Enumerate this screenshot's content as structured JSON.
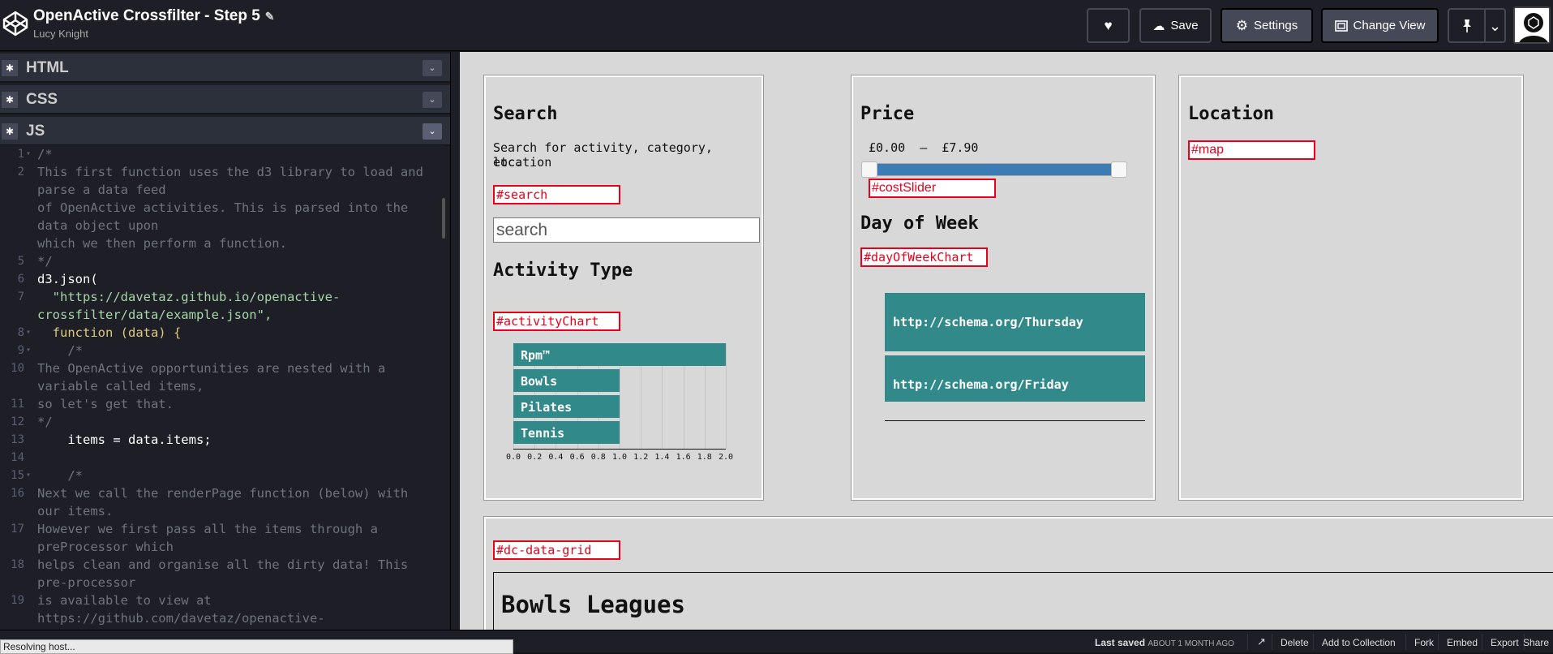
{
  "header": {
    "title": "OpenActive Crossfilter - Step 5",
    "edit_glyph": "✎",
    "author": "Lucy Knight",
    "save_label": "Save",
    "settings_label": "Settings",
    "change_view_label": "Change View",
    "heart_icon": "♥",
    "cloud_icon": "☁",
    "gear_icon": "⚙",
    "pin_icon": "📌",
    "chevron": "⌄"
  },
  "panes": {
    "html": "HTML",
    "css": "CSS",
    "js": "JS",
    "gear": "✱",
    "toggle": "⌄"
  },
  "code": [
    {
      "n": "1",
      "fold": "▾",
      "t": "/*",
      "c": "comment"
    },
    {
      "n": "2",
      "fold": "",
      "t": "This first function uses the d3 library to load and",
      "c": "comment"
    },
    {
      "n": "",
      "fold": "",
      "t": "parse a data feed",
      "c": "comment"
    },
    {
      "n": "",
      "fold": "",
      "t": "of OpenActive activities. This is parsed into the",
      "c": "comment"
    },
    {
      "n": "",
      "fold": "",
      "t": "data object upon",
      "c": "comment"
    },
    {
      "n": "",
      "fold": "",
      "t": "which we then perform a function.",
      "c": "comment"
    },
    {
      "n": "5",
      "fold": "",
      "t": "*/",
      "c": "comment"
    },
    {
      "n": "6",
      "fold": "",
      "t": "d3.json(",
      "c": "plain"
    },
    {
      "n": "7",
      "fold": "",
      "t": "  \"https://davetaz.github.io/openactive-",
      "c": "str"
    },
    {
      "n": "",
      "fold": "",
      "t": "crossfilter/data/example.json\",",
      "c": "str"
    },
    {
      "n": "8",
      "fold": "▾",
      "t": "  function (data) {",
      "c": "kw"
    },
    {
      "n": "9",
      "fold": "▾",
      "t": "    /*",
      "c": "comment"
    },
    {
      "n": "10",
      "fold": "",
      "t": "The OpenActive opportunities are nested with a",
      "c": "comment"
    },
    {
      "n": "",
      "fold": "",
      "t": "variable called items,",
      "c": "comment"
    },
    {
      "n": "11",
      "fold": "",
      "t": "so let's get that.",
      "c": "comment"
    },
    {
      "n": "12",
      "fold": "",
      "t": "*/",
      "c": "comment"
    },
    {
      "n": "13",
      "fold": "",
      "t": "    items = data.items;",
      "c": "plain"
    },
    {
      "n": "14",
      "fold": "",
      "t": "",
      "c": "plain"
    },
    {
      "n": "15",
      "fold": "▾",
      "t": "    /*",
      "c": "comment"
    },
    {
      "n": "16",
      "fold": "",
      "t": "Next we call the renderPage function (below) with",
      "c": "comment"
    },
    {
      "n": "",
      "fold": "",
      "t": "our items.",
      "c": "comment"
    },
    {
      "n": "17",
      "fold": "",
      "t": "However we first pass all the items through a",
      "c": "comment"
    },
    {
      "n": "",
      "fold": "",
      "t": "preProcessor which",
      "c": "comment"
    },
    {
      "n": "18",
      "fold": "",
      "t": "helps clean and organise all the dirty data! This",
      "c": "comment"
    },
    {
      "n": "",
      "fold": "",
      "t": "pre-processor",
      "c": "comment"
    },
    {
      "n": "19",
      "fold": "",
      "t": "is available to view at",
      "c": "comment"
    },
    {
      "n": "",
      "fold": "",
      "t": "https://github.com/davetaz/openactive-",
      "c": "comment"
    }
  ],
  "preview": {
    "search": {
      "heading": "Search",
      "desc_line1": "Search for activity, category, location",
      "desc_line2": "etc.",
      "tag": "#search",
      "placeholder": "search"
    },
    "activity": {
      "heading": "Activity Type",
      "tag": "#activityChart"
    },
    "price": {
      "heading": "Price",
      "range": "£0.00  –  £7.90",
      "min": 0.0,
      "max": 7.9,
      "tag": "#costSlider"
    },
    "dow": {
      "heading": "Day of Week",
      "tag": "#dayOfWeekChart",
      "items": [
        "http://schema.org/Thursday",
        "http://schema.org/Friday"
      ]
    },
    "location": {
      "heading": "Location",
      "tag": "#map"
    },
    "grid": {
      "tag": "#dc-data-grid",
      "first_group": "Bowls Leagues"
    }
  },
  "chart_data": {
    "type": "bar",
    "orientation": "horizontal",
    "categories": [
      "Rpm™",
      "Bowls",
      "Pilates",
      "Tennis"
    ],
    "values": [
      2,
      1,
      1,
      1
    ],
    "xlim": [
      0,
      2
    ],
    "ticks": [
      "0.0",
      "0.2",
      "0.4",
      "0.6",
      "0.8",
      "1.0",
      "1.2",
      "1.4",
      "1.6",
      "1.8",
      "2.0"
    ],
    "grid": true,
    "bar_color": "#31898a"
  },
  "footer": {
    "status": "Resolving host...",
    "last_saved_label": "Last saved",
    "last_saved_value": "ABOUT 1 MONTH AGO",
    "open_icon": "↗",
    "delete": "Delete",
    "add_to_collection": "Add to Collection",
    "fork": "Fork",
    "embed": "Embed",
    "export": "Export",
    "share": "Share"
  }
}
